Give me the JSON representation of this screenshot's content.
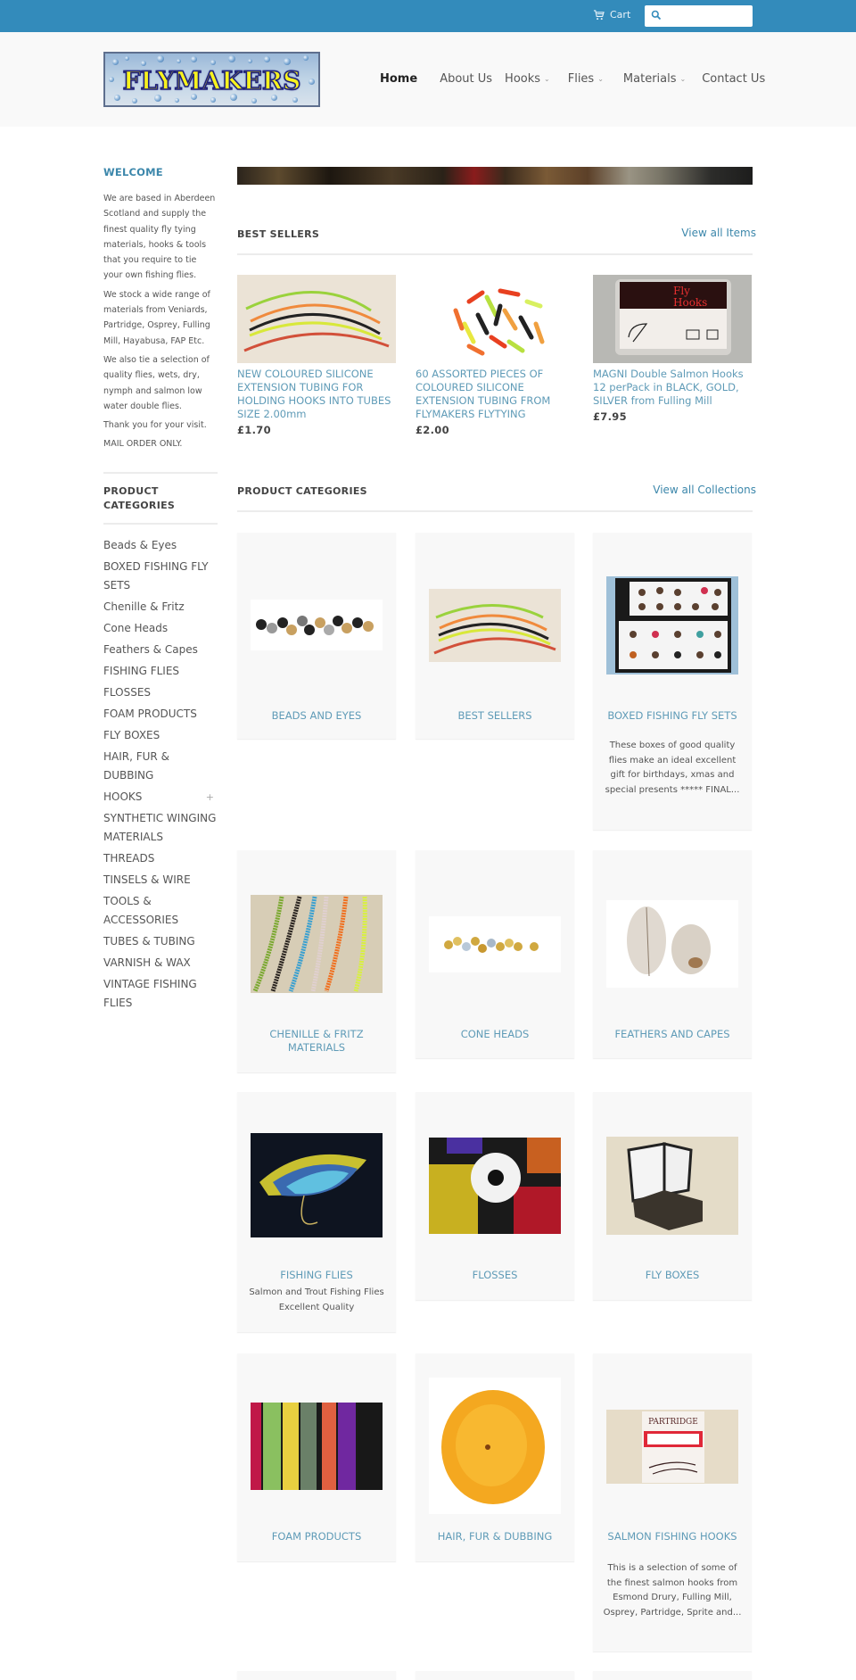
{
  "topbar": {
    "cart_label": "Cart",
    "search_placeholder": "",
    "search_value": ""
  },
  "header": {
    "logo_text": "FLYMAKERS",
    "nav": [
      {
        "label": "Home",
        "active": true,
        "dropdown": false
      },
      {
        "label": "About Us",
        "active": false,
        "dropdown": false
      },
      {
        "label": "Hooks",
        "active": false,
        "dropdown": true
      },
      {
        "label": "Flies",
        "active": false,
        "dropdown": true
      },
      {
        "label": "Materials",
        "active": false,
        "dropdown": true
      },
      {
        "label": "Contact Us",
        "active": false,
        "dropdown": false
      }
    ],
    "dropdown_glyph": "⌄"
  },
  "sidebar": {
    "welcome_title": "WELCOME",
    "welcome_paragraphs": [
      "We are based in Aberdeen Scotland and supply the finest quality fly tying materials, hooks & tools that you require to tie your own fishing flies.",
      "We stock a wide range of materials from Veniards, Partridge, Osprey, Fulling Mill, Hayabusa, FAP Etc.",
      "We also tie a selection of quality flies, wets, dry, nymph and salmon low water double flies.",
      "Thank you for your visit.",
      "MAIL ORDER ONLY."
    ],
    "categories_title": "PRODUCT CATEGORIES",
    "categories": [
      {
        "label": "Beads & Eyes"
      },
      {
        "label": "BOXED FISHING FLY SETS"
      },
      {
        "label": "Chenille & Fritz"
      },
      {
        "label": "Cone Heads"
      },
      {
        "label": "Feathers & Capes"
      },
      {
        "label": "FISHING FLIES"
      },
      {
        "label": "FLOSSES"
      },
      {
        "label": "FOAM PRODUCTS"
      },
      {
        "label": "FLY BOXES"
      },
      {
        "label": "HAIR, FUR & DUBBING"
      },
      {
        "label": "HOOKS",
        "expand_glyph": "+"
      },
      {
        "label": "SYNTHETIC WINGING MATERIALS"
      },
      {
        "label": "THREADS"
      },
      {
        "label": "TINSELS & WIRE"
      },
      {
        "label": "TOOLS & ACCESSORIES"
      },
      {
        "label": "TUBES & TUBING"
      },
      {
        "label": "VARNISH & WAX"
      },
      {
        "label": "VINTAGE FISHING FLIES"
      }
    ]
  },
  "best_sellers": {
    "title": "BEST SELLERS",
    "view_all": "View all Items",
    "items": [
      {
        "name": "NEW COLOURED SILICONE EXTENSION TUBING FOR HOLDING HOOKS INTO TUBES SIZE 2.00mm",
        "price": "£1.70",
        "image": "silicone-tubing"
      },
      {
        "name": "60 ASSORTED PIECES OF COLOURED SILICONE EXTENSION TUBING FROM FLYMAKERS FLYTYING",
        "price": "£2.00",
        "image": "assorted-tubing-pieces"
      },
      {
        "name": "MAGNI Double Salmon Hooks 12 perPack in BLACK, GOLD, SILVER from Fulling Mill",
        "price": "£7.95",
        "image": "fulling-mill-hooks-pack"
      }
    ]
  },
  "product_categories": {
    "title": "PRODUCT CATEGORIES",
    "view_all": "View all Collections",
    "collections": [
      {
        "title": "BEADS AND EYES",
        "description": "",
        "image": "beads"
      },
      {
        "title": "BEST SELLERS",
        "description": "",
        "image": "silicone-tubing"
      },
      {
        "title": "BOXED FISHING FLY SETS",
        "description": "These boxes of good quality flies make an ideal excellent gift for birthdays, xmas and special presents ***** FINAL...",
        "image": "fly-box-set"
      },
      {
        "title": "CHENILLE & FRITZ MATERIALS",
        "description": "",
        "image": "chenille"
      },
      {
        "title": "CONE HEADS",
        "description": "",
        "image": "cone-heads"
      },
      {
        "title": "FEATHERS AND CAPES",
        "description": "",
        "image": "feathers"
      },
      {
        "title": "FISHING FLIES",
        "description": "Salmon and Trout Fishing Flies Excellent Quality",
        "image": "salmon-fly"
      },
      {
        "title": "FLOSSES",
        "description": "",
        "image": "floss-spools"
      },
      {
        "title": "FLY BOXES",
        "description": "",
        "image": "fly-box"
      },
      {
        "title": "FOAM PRODUCTS",
        "description": "",
        "image": "foam-sheets"
      },
      {
        "title": "HAIR, FUR & DUBBING",
        "description": "",
        "image": "orange-fur"
      },
      {
        "title": "SALMON FISHING HOOKS",
        "description": "This is a selection of some of the finest salmon hooks from Esmond Drury, Fulling Mill, Osprey, Partridge, Sprite and...",
        "image": "partridge-hooks"
      }
    ]
  },
  "colors": {
    "topbar": "#338bbb",
    "accent_link": "#5f9bb7",
    "heading_blue": "#3c87ab",
    "header_bg": "#f9f9f9",
    "card_bg": "#f8f8f8"
  }
}
